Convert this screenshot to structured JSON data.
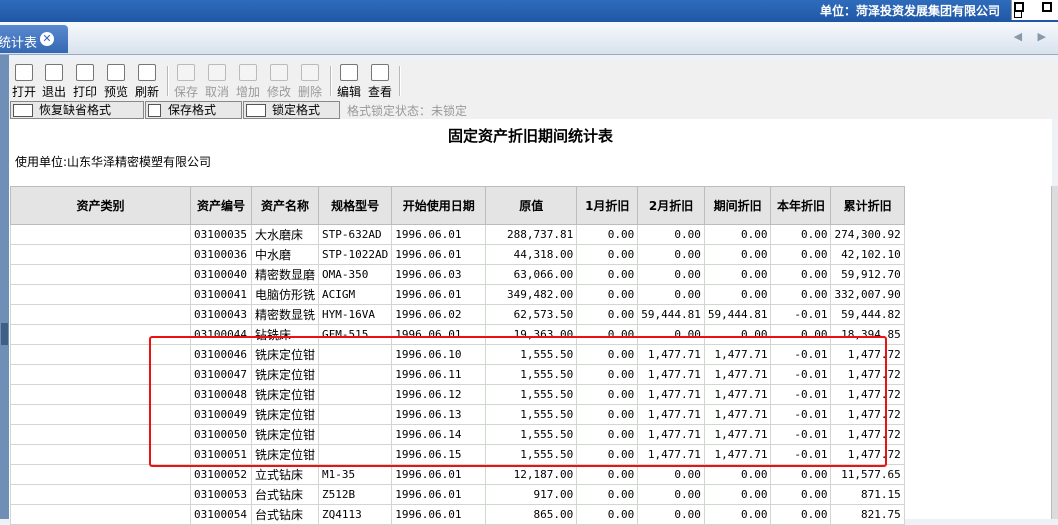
{
  "app": {
    "unit_label": "单位：菏泽投资发展集团有限公司",
    "tab_title": "统计表",
    "tab_close": "✕",
    "nav_arrows": "◀ ▶"
  },
  "toolbar": {
    "items": [
      {
        "label": "打开",
        "enabled": true
      },
      {
        "label": "退出",
        "enabled": true
      },
      {
        "label": "打印",
        "enabled": true
      },
      {
        "label": "预览",
        "enabled": true
      },
      {
        "label": "刷新",
        "enabled": true
      },
      {
        "label": "保存",
        "enabled": false
      },
      {
        "label": "取消",
        "enabled": false
      },
      {
        "label": "增加",
        "enabled": false
      },
      {
        "label": "修改",
        "enabled": false
      },
      {
        "label": "删除",
        "enabled": false
      },
      {
        "label": "编辑",
        "enabled": true
      },
      {
        "label": "查看",
        "enabled": true
      }
    ]
  },
  "format_bar": {
    "restore_default": "恢复缺省格式",
    "save_format": "保存格式",
    "lock_format": "锁定格式",
    "lock_status": "格式锁定状态：未锁定"
  },
  "report": {
    "title": "固定资产折旧期间统计表",
    "using_unit": "使用单位:山东华泽精密模塑有限公司",
    "columns": [
      "资产类别",
      "资产编号",
      "资产名称",
      "规格型号",
      "开始使用日期",
      "原值",
      "1月折旧",
      "2月折旧",
      "期间折旧",
      "本年折旧",
      "累计折旧"
    ],
    "rows": [
      [
        "",
        "03100035",
        "大水磨床",
        "STP-632AD",
        "1996.06.01",
        "288,737.81",
        "0.00",
        "0.00",
        "0.00",
        "0.00",
        "274,300.92"
      ],
      [
        "",
        "03100036",
        "中水磨",
        "STP-1022AD",
        "1996.06.01",
        "44,318.00",
        "0.00",
        "0.00",
        "0.00",
        "0.00",
        "42,102.10"
      ],
      [
        "",
        "03100040",
        "精密数显磨",
        "OMA-350",
        "1996.06.03",
        "63,066.00",
        "0.00",
        "0.00",
        "0.00",
        "0.00",
        "59,912.70"
      ],
      [
        "",
        "03100041",
        "电脑仿形铣",
        "ACIGM",
        "1996.06.01",
        "349,482.00",
        "0.00",
        "0.00",
        "0.00",
        "0.00",
        "332,007.90"
      ],
      [
        "",
        "03100043",
        "精密数显铣",
        "HYM-16VA",
        "1996.06.02",
        "62,573.50",
        "0.00",
        "59,444.81",
        "59,444.81",
        "-0.01",
        "59,444.82"
      ],
      [
        "",
        "03100044",
        "钻铣床",
        "GFM-515",
        "1996.06.01",
        "19,363.00",
        "0.00",
        "0.00",
        "0.00",
        "0.00",
        "18,394.85"
      ],
      [
        "",
        "03100046",
        "铣床定位钳",
        "",
        "1996.06.10",
        "1,555.50",
        "0.00",
        "1,477.71",
        "1,477.71",
        "-0.01",
        "1,477.72"
      ],
      [
        "",
        "03100047",
        "铣床定位钳",
        "",
        "1996.06.11",
        "1,555.50",
        "0.00",
        "1,477.71",
        "1,477.71",
        "-0.01",
        "1,477.72"
      ],
      [
        "",
        "03100048",
        "铣床定位钳",
        "",
        "1996.06.12",
        "1,555.50",
        "0.00",
        "1,477.71",
        "1,477.71",
        "-0.01",
        "1,477.72"
      ],
      [
        "",
        "03100049",
        "铣床定位钳",
        "",
        "1996.06.13",
        "1,555.50",
        "0.00",
        "1,477.71",
        "1,477.71",
        "-0.01",
        "1,477.72"
      ],
      [
        "",
        "03100050",
        "铣床定位钳",
        "",
        "1996.06.14",
        "1,555.50",
        "0.00",
        "1,477.71",
        "1,477.71",
        "-0.01",
        "1,477.72"
      ],
      [
        "",
        "03100051",
        "铣床定位钳",
        "",
        "1996.06.15",
        "1,555.50",
        "0.00",
        "1,477.71",
        "1,477.71",
        "-0.01",
        "1,477.72"
      ],
      [
        "",
        "03100052",
        "立式钻床",
        "M1-35",
        "1996.06.01",
        "12,187.00",
        "0.00",
        "0.00",
        "0.00",
        "0.00",
        "11,577.65"
      ],
      [
        "",
        "03100053",
        "台式钻床",
        "Z512B",
        "1996.06.01",
        "917.00",
        "0.00",
        "0.00",
        "0.00",
        "0.00",
        "871.15"
      ],
      [
        "",
        "03100054",
        "台式钻床",
        "ZQ4113",
        "1996.06.01",
        "865.00",
        "0.00",
        "0.00",
        "0.00",
        "0.00",
        "821.75"
      ]
    ]
  },
  "colors": {
    "highlight_box": "#ee1111",
    "banner": "#1f57a6"
  }
}
